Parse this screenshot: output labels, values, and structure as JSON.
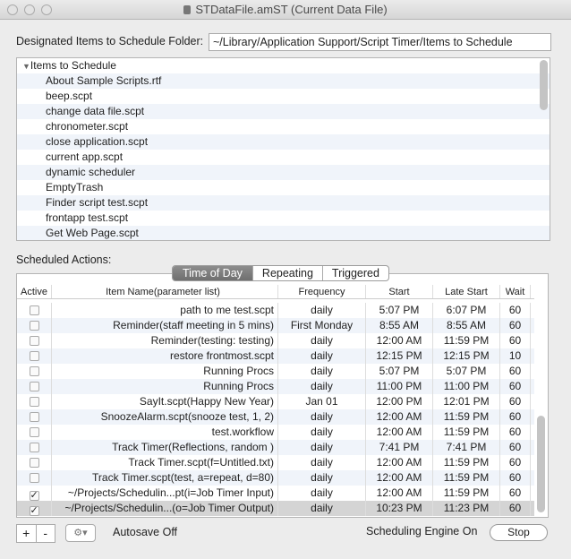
{
  "window": {
    "title": "STDataFile.amST (Current Data File)"
  },
  "folder": {
    "label": "Designated Items to Schedule Folder:",
    "value": "~/Library/Application Support/Script Timer/Items to Schedule"
  },
  "items_list": {
    "header": "Items to Schedule",
    "items": [
      "About Sample Scripts.rtf",
      "beep.scpt",
      "change data file.scpt",
      "chronometer.scpt",
      "close application.scpt",
      "current app.scpt",
      "dynamic scheduler",
      "EmptyTrash",
      "Finder script test.scpt",
      "frontapp test.scpt",
      "Get Web Page.scpt"
    ]
  },
  "scheduled": {
    "label": "Scheduled Actions:",
    "tabs": [
      {
        "label": "Time of Day",
        "active": true
      },
      {
        "label": "Repeating",
        "active": false
      },
      {
        "label": "Triggered",
        "active": false
      }
    ],
    "columns": [
      "Active",
      "Item Name(parameter list)",
      "Frequency",
      "Start",
      "Late Start",
      "Wait"
    ],
    "rows": [
      {
        "active": false,
        "name": "path to me test.scpt",
        "frequency": "daily",
        "start": "5:07 PM",
        "late": "6:07 PM",
        "wait": "60"
      },
      {
        "active": false,
        "name": "Reminder(staff meeting in 5 mins)",
        "frequency": "First Monday",
        "start": "8:55 AM",
        "late": "8:55 AM",
        "wait": "60"
      },
      {
        "active": false,
        "name": "Reminder(testing: testing)",
        "frequency": "daily",
        "start": "12:00 AM",
        "late": "11:59 PM",
        "wait": "60"
      },
      {
        "active": false,
        "name": "restore frontmost.scpt",
        "frequency": "daily",
        "start": "12:15 PM",
        "late": "12:15 PM",
        "wait": "10"
      },
      {
        "active": false,
        "name": "Running Procs",
        "frequency": "daily",
        "start": "5:07 PM",
        "late": "5:07 PM",
        "wait": "60"
      },
      {
        "active": false,
        "name": "Running Procs",
        "frequency": "daily",
        "start": "11:00 PM",
        "late": "11:00 PM",
        "wait": "60"
      },
      {
        "active": false,
        "name": "SayIt.scpt(Happy New Year)",
        "frequency": "Jan 01",
        "start": "12:00 PM",
        "late": "12:01 PM",
        "wait": "60"
      },
      {
        "active": false,
        "name": "SnoozeAlarm.scpt(snooze test, 1, 2)",
        "frequency": "daily",
        "start": "12:00 AM",
        "late": "11:59 PM",
        "wait": "60"
      },
      {
        "active": false,
        "name": "test.workflow",
        "frequency": "daily",
        "start": "12:00 AM",
        "late": "11:59 PM",
        "wait": "60"
      },
      {
        "active": false,
        "name": "Track Timer(Reflections, random )",
        "frequency": "daily",
        "start": "7:41 PM",
        "late": "7:41 PM",
        "wait": "60"
      },
      {
        "active": false,
        "name": "Track Timer.scpt(f=Untitled.txt)",
        "frequency": "daily",
        "start": "12:00 AM",
        "late": "11:59 PM",
        "wait": "60"
      },
      {
        "active": false,
        "name": "Track Timer.scpt(test, a=repeat, d=80)",
        "frequency": "daily",
        "start": "12:00 AM",
        "late": "11:59 PM",
        "wait": "60"
      },
      {
        "active": true,
        "name": "~/Projects/Schedulin...pt(i=Job Timer Input)",
        "frequency": "daily",
        "start": "12:00 AM",
        "late": "11:59 PM",
        "wait": "60"
      },
      {
        "active": true,
        "name": "~/Projects/Schedulin...(o=Job Timer Output)",
        "frequency": "daily",
        "start": "10:23 PM",
        "late": "11:23 PM",
        "wait": "60",
        "selected": true
      }
    ]
  },
  "footer": {
    "add": "+",
    "remove": "-",
    "autosave": "Autosave Off",
    "engine_status": "Scheduling Engine On",
    "stop": "Stop"
  }
}
